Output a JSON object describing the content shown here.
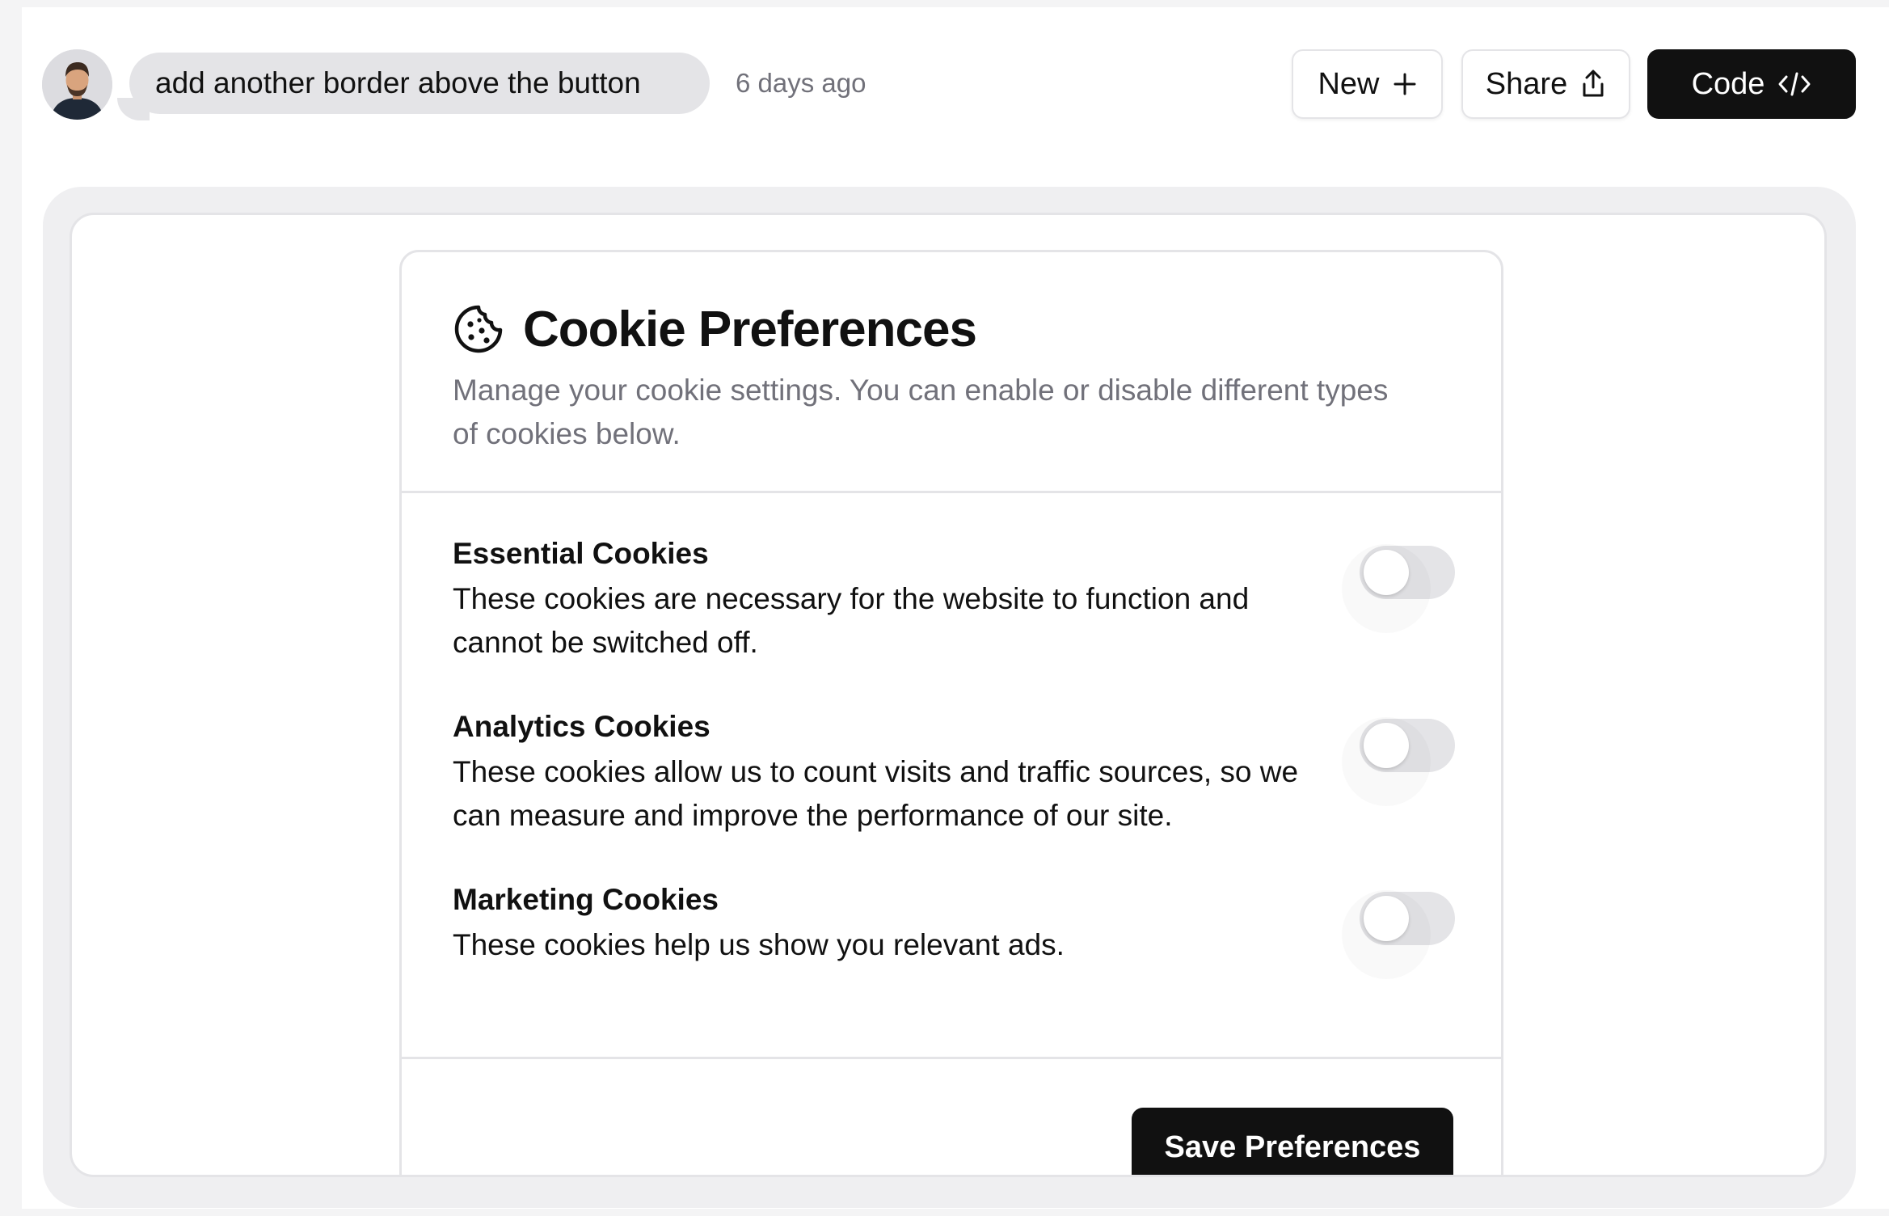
{
  "header": {
    "message": "add another border above the button",
    "timestamp": "6 days ago",
    "new_label": "New",
    "share_label": "Share",
    "code_label": "Code"
  },
  "card": {
    "title": "Cookie Preferences",
    "subtitle": "Manage your cookie settings. You can enable or disable different types of cookies below.",
    "items": [
      {
        "title": "Essential Cookies",
        "description": "These cookies are necessary for the website to function and cannot be switched off.",
        "enabled": false
      },
      {
        "title": "Analytics Cookies",
        "description": "These cookies allow us to count visits and traffic sources, so we can measure and improve the performance of our site.",
        "enabled": false
      },
      {
        "title": "Marketing Cookies",
        "description": "These cookies help us show you relevant ads.",
        "enabled": false
      }
    ],
    "save_label": "Save Preferences"
  }
}
